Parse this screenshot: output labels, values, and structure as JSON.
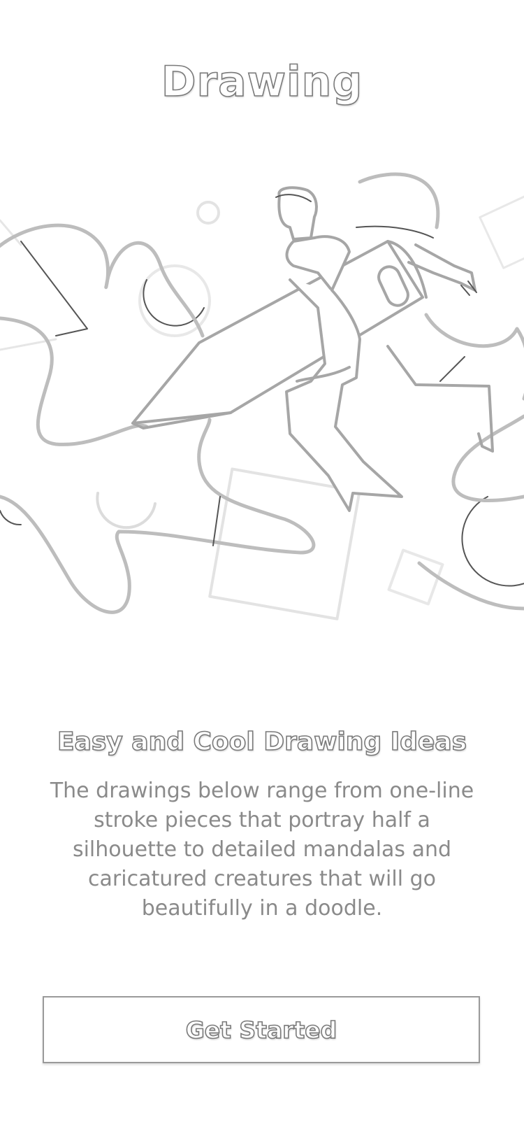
{
  "header": {
    "title": "Drawing"
  },
  "hero": {
    "illustration": "person-riding-pencil-illustration"
  },
  "content": {
    "headline": "Easy and Cool Drawing Ideas",
    "description": "The drawings below range from one-line stroke pieces that portray half a silhouette to detailed mandalas and caricatured creatures that will go beautifully in a doodle."
  },
  "cta": {
    "label": "Get Started"
  },
  "colors": {
    "background": "#ffffff",
    "stroke": "#8a8a8a",
    "text": "#8a8a8a"
  }
}
